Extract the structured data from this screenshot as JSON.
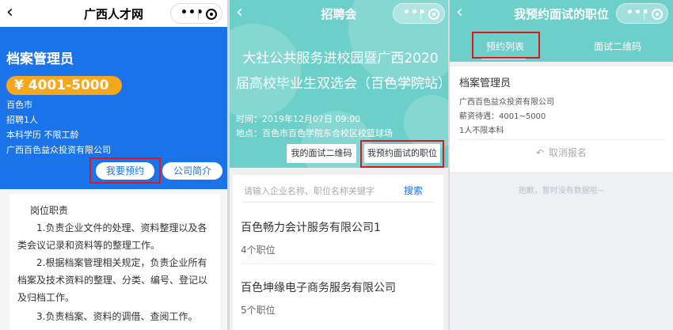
{
  "panel1": {
    "nav": {
      "title": "广西人才网",
      "back_icon": "chevron-left-icon",
      "capsule_dots": "•••"
    },
    "job": {
      "title": "档案管理员",
      "salary": "¥ 4001-5000",
      "city": "百色市",
      "headcount": "招聘1人",
      "requirements": "本科学历    不限工龄",
      "company": "广西百色益众投资有限公司"
    },
    "buttons": {
      "apply": "我要预约",
      "company_intro": "公司简介"
    },
    "duties": {
      "title": "岗位职责",
      "p1": "1.负责企业文件的处理、资料整理以及各类会议记录和资料等的整理工作。",
      "p2": "2.根据档案管理相关规定，负责企业所有档案及技术资料的整理、分类、编号、登记以及归档工作。",
      "p3": "3.负责档案、资料的调借、查阅工作。"
    }
  },
  "panel2": {
    "nav": {
      "title": "招聘会",
      "back_icon": "chevron-left-icon",
      "capsule_dots": "•••"
    },
    "fair": {
      "title": "大社公共服务进校园暨广西2020届高校毕业生双选会（百色学院站）",
      "time": "时间：2019年12月07日 09:00",
      "location": "地点：百色市百色学院东合校区校篮球场"
    },
    "buttons": {
      "my_qr": "我的面试二维码",
      "my_jobs": "我预约面试的职位"
    },
    "search": {
      "placeholder": "请输入企业名称、职位名称关键字",
      "button": "搜索"
    },
    "companies": [
      {
        "name": "百色畅力会计服务有限公司1",
        "count": "4个职位"
      },
      {
        "name": "百色坤缘电子商务服务有限公司",
        "count": "5个职位"
      }
    ]
  },
  "panel3": {
    "nav": {
      "title": "我预约面试的职位",
      "back_icon": "chevron-left-icon",
      "capsule_dots": "•••"
    },
    "tabs": {
      "list": "预约列表",
      "qr": "面试二维码"
    },
    "application": {
      "title": "档案管理员",
      "company": "广西百色益众投资有限公司",
      "salary": "薪资待遇：4001~5000",
      "requirements": "1人不限本科",
      "cancel": "取消报名",
      "cancel_icon": "undo-icon"
    },
    "empty_note": "抱歉，暂时没有数据啦~"
  },
  "colors": {
    "brand_blue": "#1a73e8",
    "teal": "#6ccfc9",
    "salary_orange": "#f7a71b",
    "highlight_red": "#e0161e"
  }
}
